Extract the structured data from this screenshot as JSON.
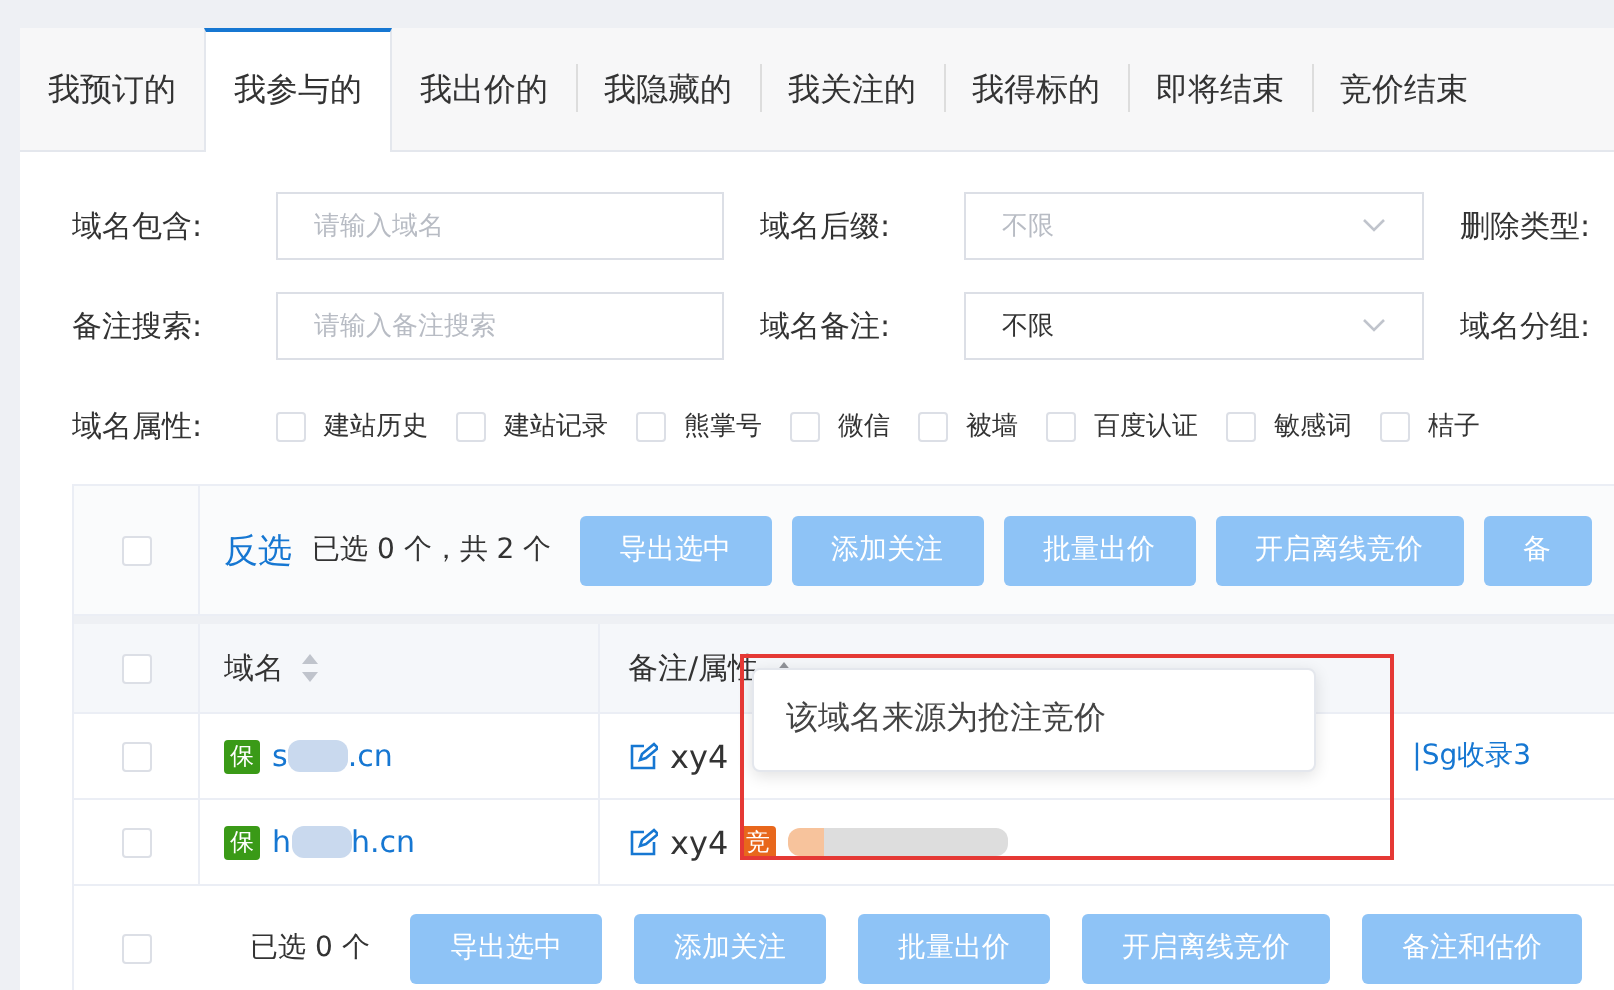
{
  "tabs": [
    {
      "label": "我预订的",
      "selected": false
    },
    {
      "label": "我参与的",
      "selected": true
    },
    {
      "label": "我出价的",
      "selected": false
    },
    {
      "label": "我隐藏的",
      "selected": false
    },
    {
      "label": "我关注的",
      "selected": false
    },
    {
      "label": "我得标的",
      "selected": false
    },
    {
      "label": "即将结束",
      "selected": false
    },
    {
      "label": "竞价结束",
      "selected": false
    }
  ],
  "filters": [
    [
      {
        "label": "域名包含:",
        "kind": "input",
        "placeholder": "请输入域名"
      },
      {
        "label": "域名后缀:",
        "kind": "select",
        "placeholder": "不限"
      },
      {
        "label": "删除类型:",
        "kind": "none"
      }
    ],
    [
      {
        "label": "备注搜索:",
        "kind": "input",
        "placeholder": "请输入备注搜索"
      },
      {
        "label": "域名备注:",
        "kind": "select",
        "value": "不限"
      },
      {
        "label": "域名分组:",
        "kind": "none"
      }
    ]
  ],
  "attributes": {
    "label": "域名属性:",
    "options": [
      {
        "label": "建站历史",
        "checked": false
      },
      {
        "label": "建站记录",
        "checked": false
      },
      {
        "label": "熊掌号",
        "checked": false
      },
      {
        "label": "微信",
        "checked": false
      },
      {
        "label": "被墙",
        "checked": false
      },
      {
        "label": "百度认证",
        "checked": false
      },
      {
        "label": "敏感词",
        "checked": false
      },
      {
        "label": "桔子",
        "checked": false
      }
    ]
  },
  "toolbar": {
    "checked": false,
    "invert_link": "反选",
    "summary": "已选 0 个，共 2 个",
    "buttons": [
      "导出选中",
      "添加关注",
      "批量出价",
      "开启离线竞价",
      "备"
    ]
  },
  "table": {
    "header_checked": false,
    "columns": [
      "域名",
      "备注/属性"
    ],
    "rows": [
      {
        "checked": false,
        "badge": "保",
        "name_start": "s",
        "name_end": ".cn",
        "remark": "xy4",
        "tag": "",
        "extra": "|Sg收录3"
      },
      {
        "checked": false,
        "badge": "保",
        "name_start": "h",
        "name_end": "h.cn",
        "remark": "xy4",
        "tag": "竞",
        "extra": ""
      }
    ]
  },
  "footer": {
    "checked": false,
    "summary": "已选 0 个",
    "buttons": [
      "导出选中",
      "添加关注",
      "批量出价",
      "开启离线竞价",
      "备注和估价"
    ]
  },
  "tooltip": "该域名来源为抢注竞价"
}
